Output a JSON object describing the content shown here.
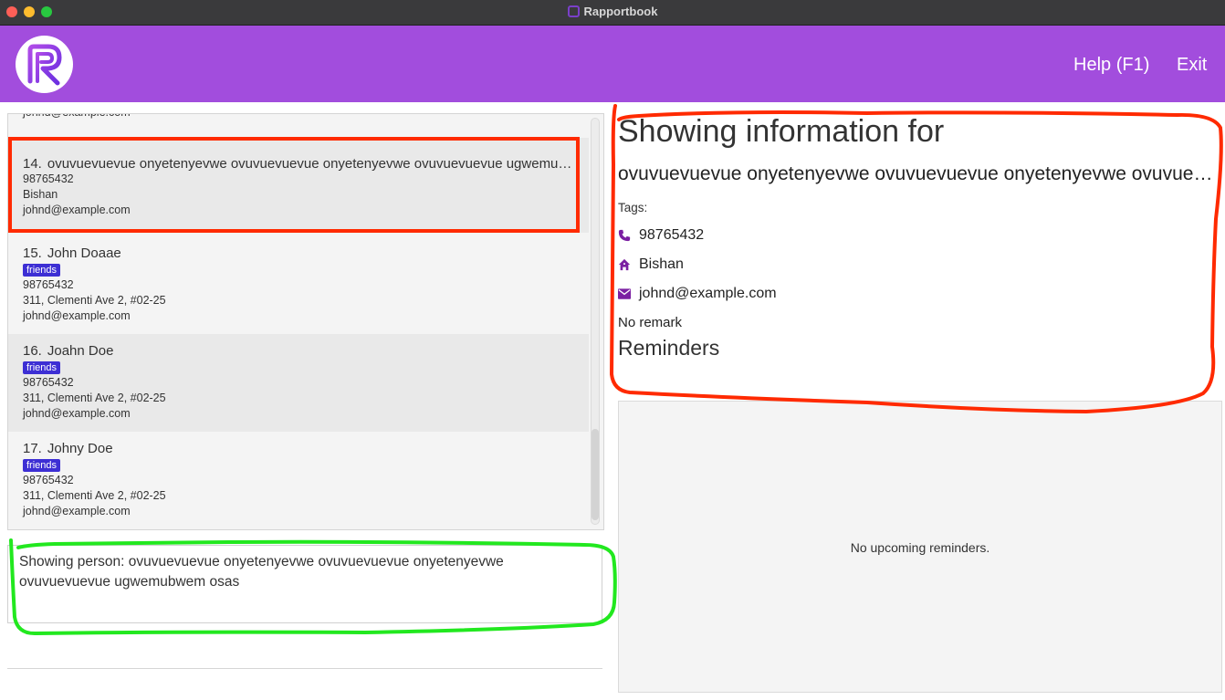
{
  "window": {
    "title": "Rapportbook"
  },
  "menu": {
    "help": "Help (F1)",
    "exit": "Exit"
  },
  "list": {
    "partial_email": "johnd@example.com",
    "items": [
      {
        "index": "14.",
        "name": "ovuvuevuevue onyetenyevwe ovuvuevuevue onyetenyevwe ovuvuevuevue ugwemubwem osas",
        "phone": "98765432",
        "address": "Bishan",
        "email": "johnd@example.com"
      },
      {
        "index": "15.",
        "name": "John Doaae",
        "tag": "friends",
        "phone": "98765432",
        "address": "311, Clementi Ave 2, #02-25",
        "email": "johnd@example.com"
      },
      {
        "index": "16.",
        "name": "Joahn Doe",
        "tag": "friends",
        "phone": "98765432",
        "address": "311, Clementi Ave 2, #02-25",
        "email": "johnd@example.com"
      },
      {
        "index": "17.",
        "name": "Johny Doe",
        "tag": "friends",
        "phone": "98765432",
        "address": "311, Clementi Ave 2, #02-25",
        "email": "johnd@example.com"
      }
    ]
  },
  "result": {
    "text": "Showing person: ovuvuevuevue onyetenyevwe ovuvuevuevue onyetenyevwe ovuvuevuevue ugwemubwem osas"
  },
  "detail": {
    "heading": "Showing information for",
    "name": "ovuvuevuevue onyetenyevwe ovuvuevuevue onyetenyevwe ovuvuevuevue ugwemubwem osas",
    "tags_label": "Tags:",
    "phone": "98765432",
    "address": "Bishan",
    "email": "johnd@example.com",
    "remark": "No remark",
    "reminders_heading": "Reminders",
    "reminders_empty": "No upcoming reminders."
  },
  "icons": {
    "phone": "phone-icon",
    "address": "home-icon",
    "email": "envelope-icon"
  },
  "colors": {
    "header": "#a24ddd",
    "tag": "#3d2fd4",
    "icon": "#7b1fa2",
    "annotation_red": "#ff2a00",
    "annotation_green": "#22e81f"
  }
}
